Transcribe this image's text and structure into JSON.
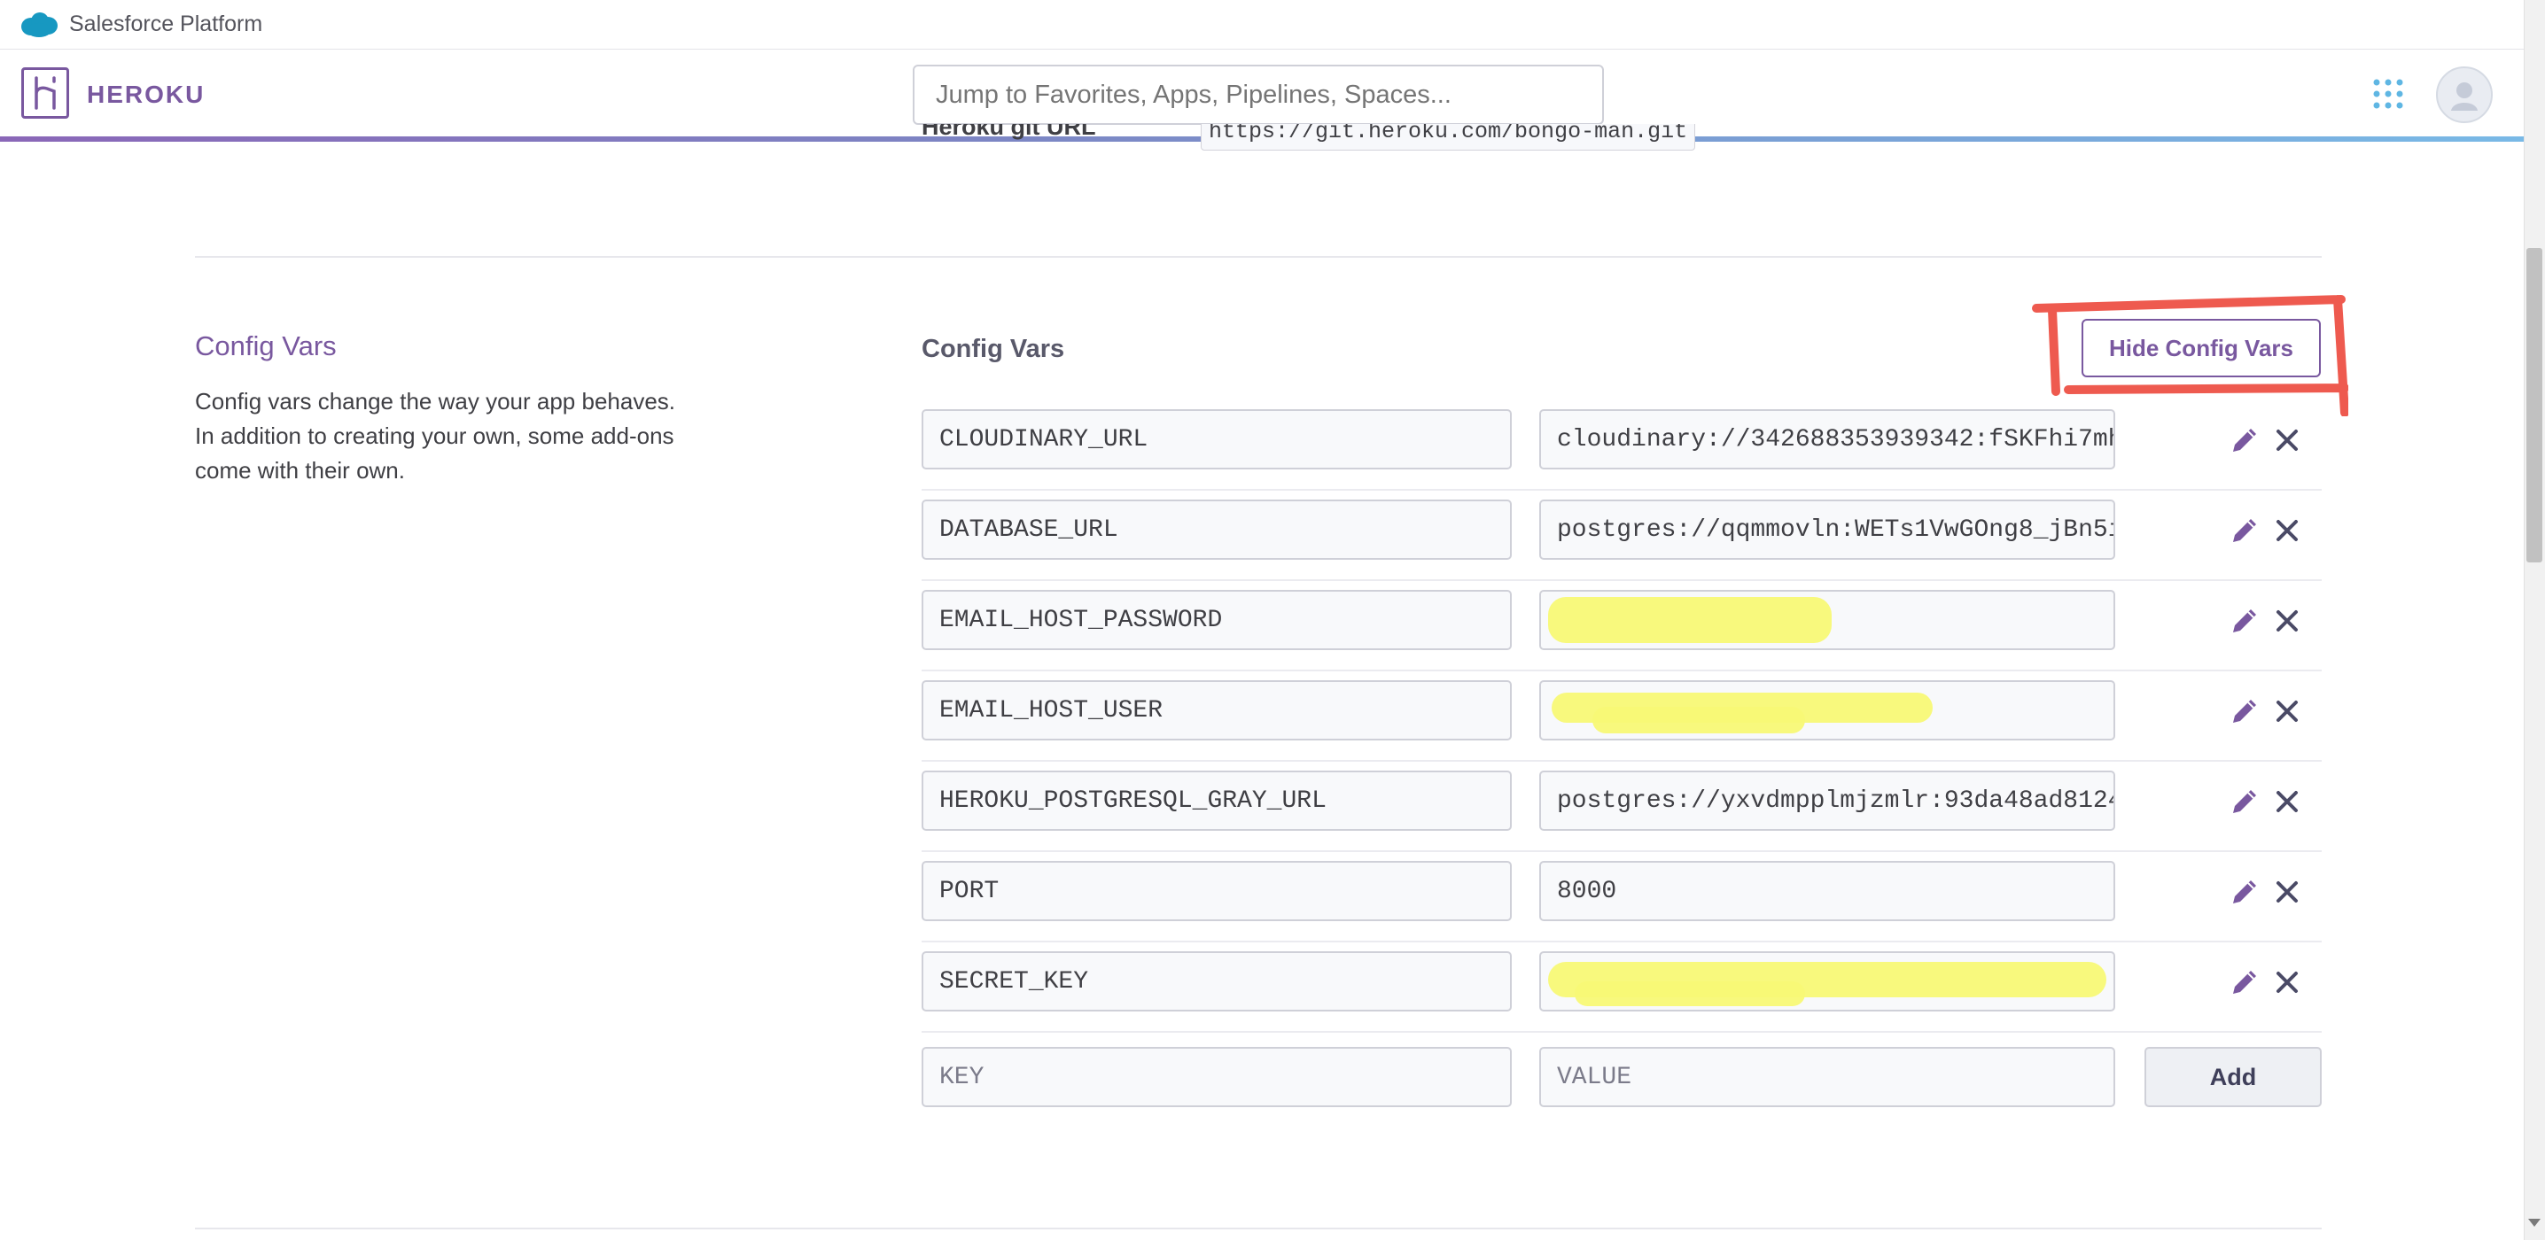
{
  "salesforce_bar": {
    "title": "Salesforce Platform",
    "icon": "salesforce-cloud-icon"
  },
  "header": {
    "wordmark": "HEROKU",
    "search_placeholder": "Jump to Favorites, Apps, Pipelines, Spaces...",
    "apps_icon": "apps-grid-icon",
    "avatar_icon": "user-avatar-icon"
  },
  "git": {
    "label": "Heroku git URL",
    "value": "https://git.heroku.com/bongo-man.git"
  },
  "config_section": {
    "title": "Config Vars",
    "description": "Config vars change the way your app behaves. In addition to creating your own, some add-ons come with their own."
  },
  "config_panel": {
    "title": "Config Vars",
    "hide_button": "Hide Config Vars",
    "vars": [
      {
        "key": "CLOUDINARY_URL",
        "value": "cloudinary://342688353939342:fSKFhi7mh",
        "redacted": false
      },
      {
        "key": "DATABASE_URL",
        "value": "postgres://qqmmovln:WETs1VwGOng8_jBn5i",
        "redacted": false
      },
      {
        "key": "EMAIL_HOST_PASSWORD",
        "value": "",
        "redacted": true
      },
      {
        "key": "EMAIL_HOST_USER",
        "value": "",
        "redacted": true
      },
      {
        "key": "HEROKU_POSTGRESQL_GRAY_URL",
        "value": "postgres://yxvdmpplmjzmlr:93da48ad8124",
        "redacted": false
      },
      {
        "key": "PORT",
        "value": "8000",
        "redacted": false
      },
      {
        "key": "SECRET_KEY",
        "value": "",
        "redacted": true
      }
    ],
    "new_key_placeholder": "KEY",
    "new_value_placeholder": "VALUE",
    "add_button": "Add"
  },
  "colors": {
    "heroku_purple": "#79589f",
    "highlight_red": "#ee5a4f",
    "redaction_yellow": "#f8f976"
  }
}
